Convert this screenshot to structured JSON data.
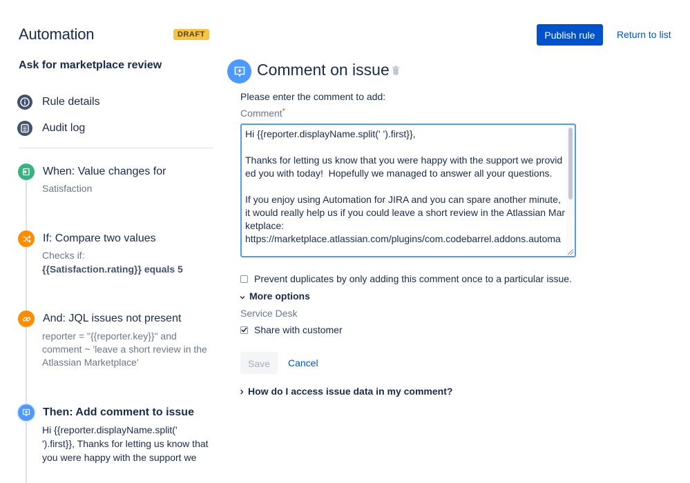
{
  "header": {
    "app_title": "Automation",
    "status_badge": "DRAFT",
    "publish_label": "Publish rule",
    "return_label": "Return to list"
  },
  "sidebar": {
    "rule_name": "Ask for marketplace review",
    "nav": [
      {
        "label": "Rule details",
        "icon": "info-icon"
      },
      {
        "label": "Audit log",
        "icon": "list-icon"
      }
    ],
    "steps": [
      {
        "title": "When: Value changes for",
        "lines": [
          "Satisfaction"
        ],
        "icon": "trigger-icon",
        "color": "#36b37e"
      },
      {
        "title": "If: Compare two values",
        "lines": [
          "Checks if:"
        ],
        "bold_line": "{{Satisfaction.rating}} equals 5",
        "icon": "shuffle-icon",
        "color": "#ff8b00"
      },
      {
        "title": "And: JQL issues not present",
        "lines": [
          "reporter = \"{{reporter.key}}\" and",
          "comment ~ 'leave a short review in the",
          "Atlassian Marketplace'"
        ],
        "icon": "link-icon",
        "color": "#ff8b00"
      },
      {
        "title": "Then: Add comment to issue",
        "lines": [
          "Hi {{reporter.displayName.split('",
          "').first}}, Thanks for letting us know that",
          "you were happy with the support we"
        ],
        "icon": "comment-icon",
        "color": "#4c9aff"
      }
    ]
  },
  "main": {
    "title": "Comment on issue",
    "instruction": "Please enter the comment to add:",
    "field_label": "Comment",
    "required_mark": "*",
    "comment_text": "Hi {{reporter.displayName.split(' ').first}},\n\nThanks for letting us know that you were happy with the support we provided you with today!  Hopefully we managed to answer all your questions.\n\nIf you enjoy using Automation for JIRA and you can spare another minute, it would really help us if you could leave a short review in the Atlassian Marketplace:\nhttps://marketplace.atlassian.com/plugins/com.codebarrel.addons.automa",
    "prevent_duplicates_label": "Prevent duplicates by only adding this comment once to a particular issue.",
    "prevent_duplicates_checked": false,
    "more_options_label": "More options",
    "service_desk_label": "Service Desk",
    "share_label": "Share with customer",
    "share_checked": true,
    "save_label": "Save",
    "cancel_label": "Cancel",
    "help_label": "How do I access issue data in my comment?"
  },
  "colors": {
    "primary": "#0052cc",
    "badge": "#f6c342",
    "text": "#172b4d",
    "subtle": "#6b778c"
  }
}
